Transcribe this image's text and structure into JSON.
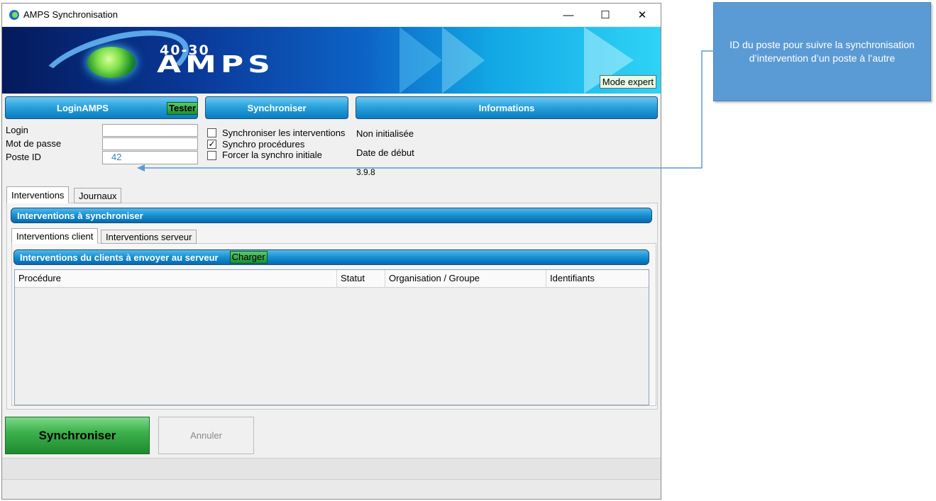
{
  "window": {
    "title": "AMPS Synchronisation",
    "controls": {
      "minimize": "—",
      "maximize": "☐",
      "close": "✕"
    }
  },
  "banner": {
    "logo_small": "40-30",
    "logo_main": "AMPS",
    "mode_expert_label": "Mode expert"
  },
  "sections": {
    "login": {
      "title": "LoginAMPS",
      "test_button": "Tester"
    },
    "sync": {
      "title": "Synchroniser"
    },
    "info": {
      "title": "Informations"
    }
  },
  "login_form": {
    "login_label": "Login",
    "login_value": "",
    "password_label": "Mot de passe",
    "password_value": "",
    "poste_label": "Poste ID",
    "poste_value": "42"
  },
  "options": [
    {
      "label": "Synchroniser les interventions",
      "checked": false
    },
    {
      "label": "Synchro procédures",
      "checked": true
    },
    {
      "label": "Forcer la synchro initiale",
      "checked": false
    }
  ],
  "info": {
    "status": "Non initialisée",
    "start_date_label": "Date de début",
    "version": "3.9.8"
  },
  "tabs": {
    "main": [
      "Interventions",
      "Journaux"
    ],
    "main_active": "Interventions",
    "section_title": "Interventions à synchroniser",
    "sub": [
      "Interventions client",
      "Interventions serveur"
    ],
    "sub_active": "Interventions client",
    "subsection_title": "Interventions du clients à envoyer au serveur",
    "load_button": "Charger"
  },
  "table": {
    "columns": [
      "Procédure",
      "Statut",
      "Organisation / Groupe",
      "Identifiants"
    ],
    "rows": []
  },
  "buttons": {
    "sync": "Synchroniser",
    "cancel": "Annuler"
  },
  "callout": {
    "text": "ID du poste pour suivre la synchronisation d’intervention d’un poste à l’autre"
  },
  "colors": {
    "header_blue": "#1a8fd3",
    "sync_green": "#2fa73f",
    "callout_blue": "#5b9bd5",
    "arrow": "#5b9bd5"
  }
}
